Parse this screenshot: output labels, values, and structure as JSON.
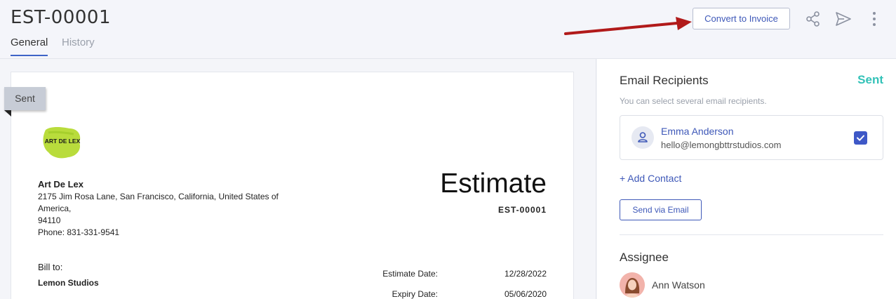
{
  "header": {
    "title": "EST-00001",
    "tabs": [
      {
        "label": "General",
        "active": true
      },
      {
        "label": "History",
        "active": false
      }
    ],
    "convert_label": "Convert to Invoice",
    "icons": [
      "share-icon",
      "send-icon",
      "more-vertical-icon"
    ],
    "accent_color": "#3e58b8"
  },
  "preview": {
    "status_ribbon": "Sent",
    "logo_text": "ART DE LEX",
    "company": {
      "name": "Art De Lex",
      "address_lines": [
        "2175 Jim Rosa Lane, San Francisco, California, United States of America,",
        "94110",
        "Phone: 831-331-9541"
      ]
    },
    "doc_heading": "Estimate",
    "doc_number": "EST-00001",
    "bill_to_label": "Bill to:",
    "bill_to_name": "Lemon Studios",
    "meta": [
      {
        "label": "Estimate Date:",
        "value": "12/28/2022"
      },
      {
        "label": "Expiry Date:",
        "value": "05/06/2020"
      }
    ]
  },
  "side": {
    "recipients_title": "Email Recipients",
    "status": "Sent",
    "status_color": "#33c2b8",
    "hint": "You can select several email recipients.",
    "contact": {
      "name": "Emma Anderson",
      "email": "hello@lemongbttrstudios.com",
      "checked": true
    },
    "add_contact": "+ Add Contact",
    "send_email": "Send via Email",
    "assignee_title": "Assignee",
    "assignee_name": "Ann Watson"
  }
}
